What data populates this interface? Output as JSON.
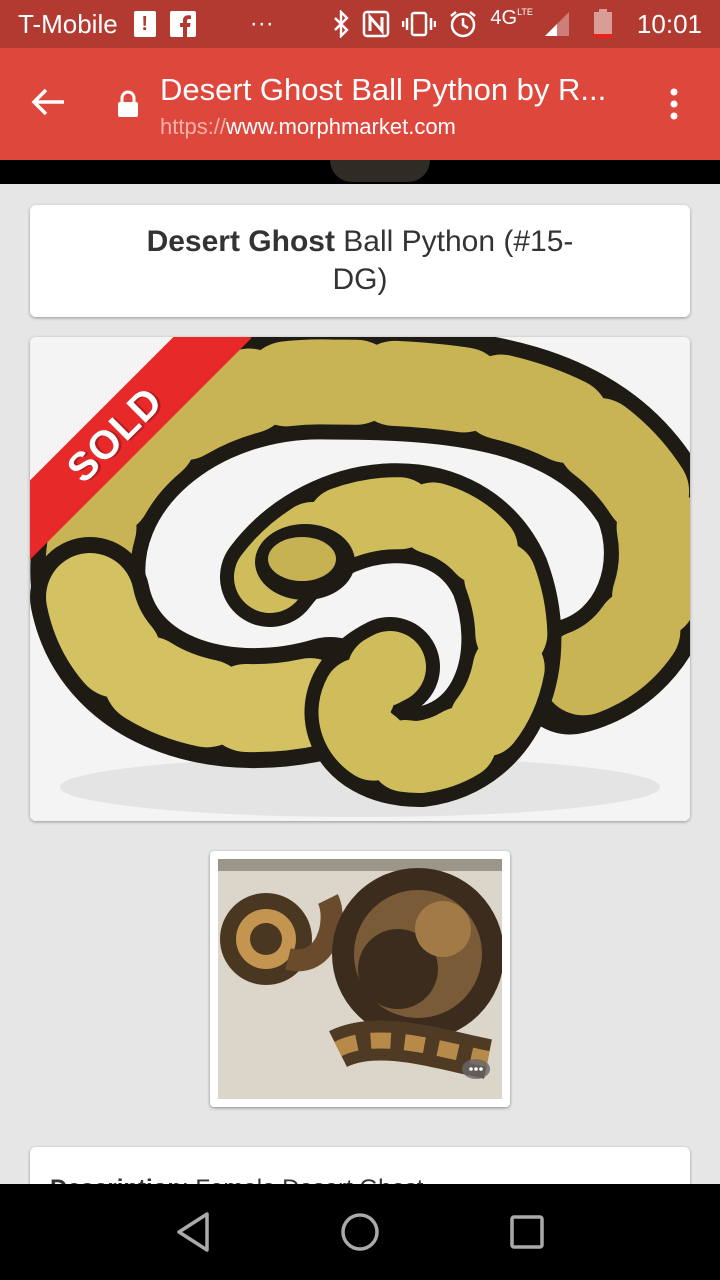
{
  "status": {
    "carrier": "T-Mobile",
    "dots": "···",
    "network": "4G",
    "network_sub": "LTE",
    "time": "10:01"
  },
  "toolbar": {
    "title": "Desert Ghost Ball Python by R...",
    "url_scheme": "https://",
    "url_host": "www.morphmarket.com"
  },
  "listing": {
    "title_bold": "Desert Ghost",
    "title_rest": " Ball Python (#15-DG)",
    "sold_label": "SOLD",
    "description_label": "Description",
    "description_text": "Female Desert Ghost"
  },
  "colors": {
    "status_bar": "#b23a30",
    "toolbar": "#de473c",
    "sold_ribbon": "#e8292a"
  }
}
